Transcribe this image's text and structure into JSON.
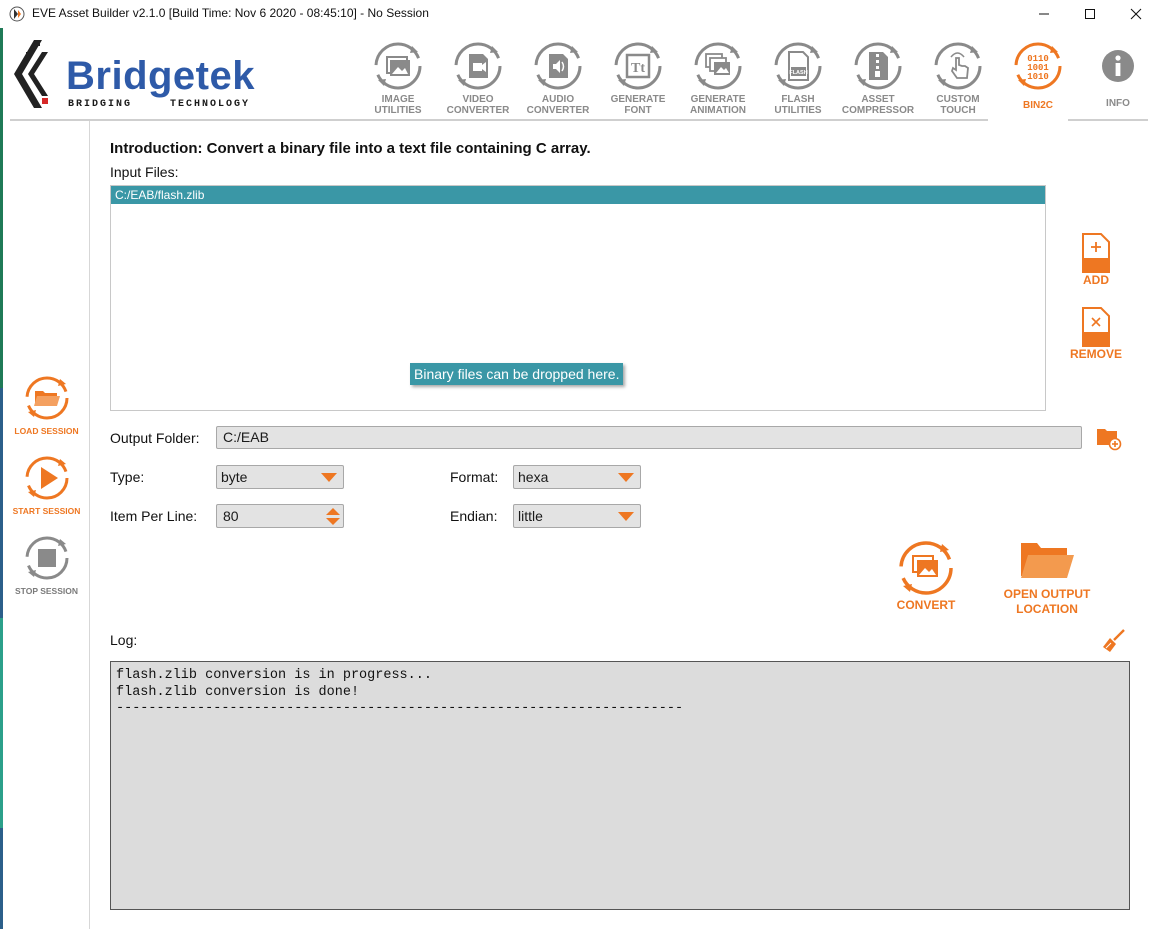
{
  "window": {
    "title": "EVE Asset Builder v2.1.0 [Build Time: Nov  6 2020 - 08:45:10] - No Session",
    "min_icon": "minimize-icon",
    "max_icon": "maximize-icon",
    "close_icon": "close-icon"
  },
  "brand": {
    "name": "Bridgetek",
    "tagline_left": "BRIDGING",
    "tagline_right": "TECHNOLOGY",
    "color": "#2e5aa8"
  },
  "toolbar": {
    "items": [
      {
        "label": "IMAGE\nUTILITIES",
        "icon": "image-icon"
      },
      {
        "label": "VIDEO\nCONVERTER",
        "icon": "video-icon"
      },
      {
        "label": "AUDIO\nCONVERTER",
        "icon": "audio-icon"
      },
      {
        "label": "GENERATE\nFONT",
        "icon": "font-icon"
      },
      {
        "label": "GENERATE\nANIMATION",
        "icon": "animation-icon"
      },
      {
        "label": "FLASH\nUTILITIES",
        "icon": "flash-icon"
      },
      {
        "label": "ASSET\nCOMPRESSOR",
        "icon": "zip-icon"
      },
      {
        "label": "CUSTOM\nTOUCH",
        "icon": "touch-icon"
      },
      {
        "label": "BIN2C",
        "icon": "binary-icon",
        "active": true
      },
      {
        "label": "INFO",
        "icon": "info-icon"
      }
    ],
    "binary_glyph": [
      "0110",
      "1001",
      "1010"
    ],
    "flash_glyph": "FLASH",
    "font_glyph": "Tt"
  },
  "sidebar": {
    "load": "LOAD SESSION",
    "start": "START SESSION",
    "stop": "STOP SESSION"
  },
  "main": {
    "intro": "Introduction: Convert a binary file into a text file containing C array.",
    "input_files_label": "Input Files:",
    "files": [
      "C:/EAB/flash.zlib"
    ],
    "drop_hint": "Binary files can be dropped here.",
    "add_label": "ADD",
    "remove_label": "REMOVE",
    "output_folder_label": "Output Folder:",
    "output_folder": "C:/EAB",
    "type_label": "Type:",
    "type_value": "byte",
    "format_label": "Format:",
    "format_value": "hexa",
    "item_per_line_label": "Item Per Line:",
    "item_per_line_value": "80",
    "endian_label": "Endian:",
    "endian_value": "little",
    "convert_label": "CONVERT",
    "open_output_label": "OPEN OUTPUT\nLOCATION",
    "log_label": "Log:",
    "log_text": "flash.zlib conversion is in progress...\nflash.zlib conversion is done!\n----------------------------------------------------------------------"
  },
  "colors": {
    "accent": "#ee7722",
    "selection": "#3a97a6",
    "inactive": "#8a8a8a"
  }
}
